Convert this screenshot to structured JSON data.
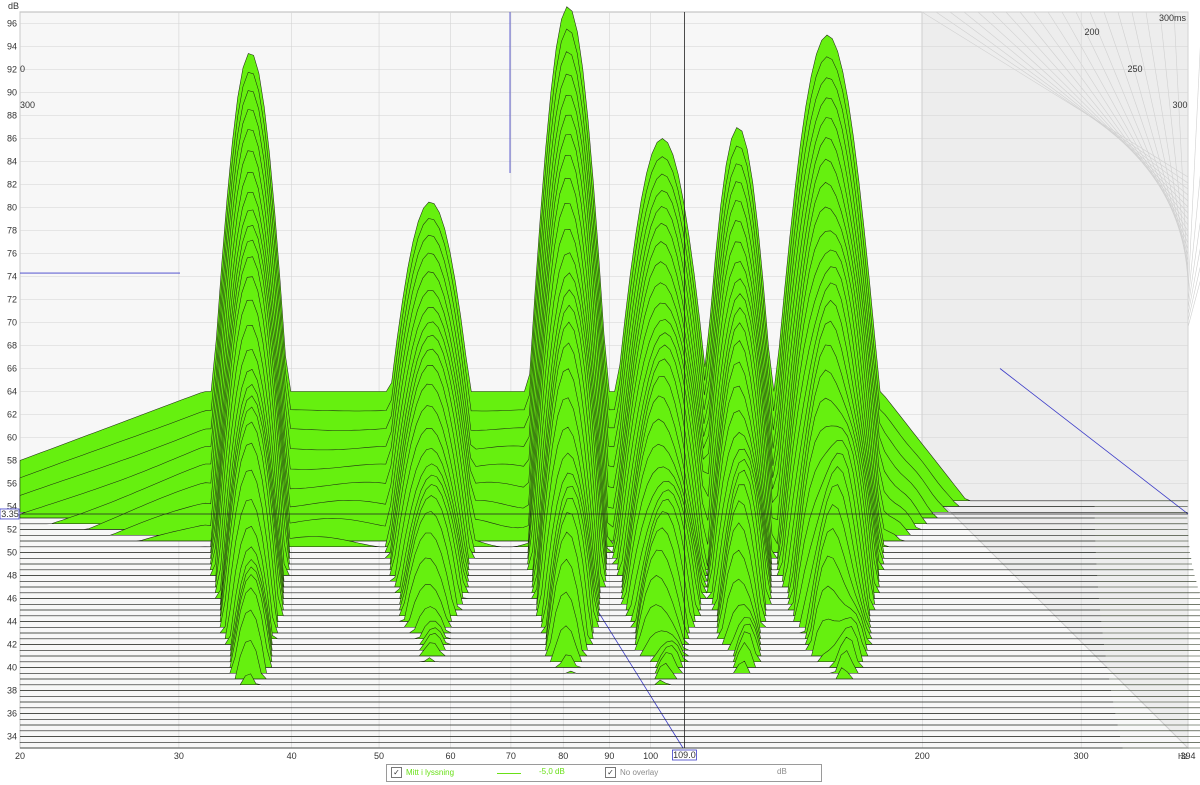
{
  "chart_data": {
    "type": "area",
    "subtype": "waterfall",
    "x_axis": {
      "scale": "log",
      "range": [
        20,
        394
      ],
      "tick_labels": [
        "20",
        "30",
        "40",
        "50",
        "60",
        "70",
        "80",
        "90",
        "100",
        "200",
        "300",
        "394"
      ],
      "tick_values": [
        20,
        30,
        40,
        50,
        60,
        70,
        80,
        90,
        100,
        200,
        300,
        394
      ],
      "unit": "Hz"
    },
    "y_axis": {
      "label": "dB",
      "range": [
        33,
        97
      ],
      "tick_labels": [
        "34",
        "36",
        "38",
        "40",
        "42",
        "44",
        "46",
        "48",
        "50",
        "52",
        "54",
        "56",
        "58",
        "60",
        "62",
        "64",
        "66",
        "68",
        "70",
        "72",
        "74",
        "76",
        "78",
        "80",
        "82",
        "84",
        "86",
        "88",
        "90",
        "92",
        "94",
        "96"
      ]
    },
    "time_axis": {
      "max_label": "300ms",
      "tick_labels": [
        "200",
        "250",
        "300"
      ],
      "left_labels": [
        "0",
        "300"
      ]
    },
    "cursor": {
      "frequency_label": "109.0",
      "level_label": "3.35",
      "frequency": 109,
      "level": 53.35
    },
    "fill_color": "#66f00f",
    "slice_count": 44,
    "peaks": [
      {
        "f": 36,
        "db": 93.5
      },
      {
        "f": 57,
        "db": 80.5
      },
      {
        "f": 81,
        "db": 97.5
      },
      {
        "f": 103,
        "db": 86
      },
      {
        "f": 125,
        "db": 87
      },
      {
        "f": 157,
        "db": 95
      }
    ]
  },
  "legend": {
    "series_label": "Mitt i lyssning",
    "series_checked": "✓",
    "smoothing": "-5,0 dB",
    "overlay_checked": "✓",
    "overlay_label": "No overlay",
    "overlay_unit": "dB"
  }
}
